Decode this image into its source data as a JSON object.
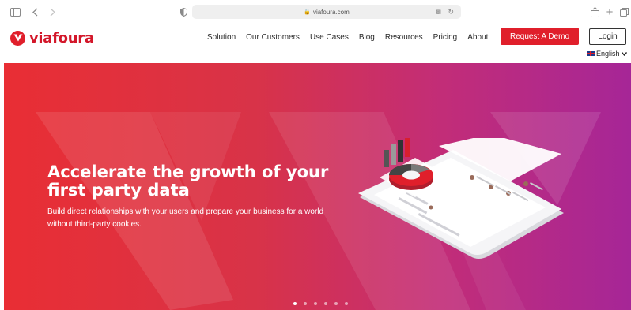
{
  "browser": {
    "url": "viafoura.com"
  },
  "header": {
    "logo_text": "viafoura",
    "nav": [
      "Solution",
      "Our Customers",
      "Use Cases",
      "Blog",
      "Resources",
      "Pricing",
      "About"
    ],
    "demo_label": "Request A Demo",
    "login_label": "Login",
    "language_label": "English"
  },
  "hero": {
    "headline_bold_1": "Accelerate the growth",
    "headline_regular": " of your ",
    "headline_bold_2": "first party data",
    "subtitle": "Build direct relationships with your users and prepare your business for a world without third-party cookies.",
    "slides": 6,
    "active_slide": 1
  },
  "colors": {
    "brand_red": "#e01f2b",
    "hero_start": "#e92e34",
    "hero_end": "#a62697"
  }
}
